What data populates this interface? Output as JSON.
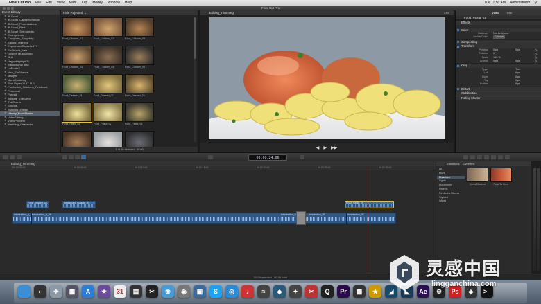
{
  "menubar": {
    "app": "Final Cut Pro",
    "items": [
      "File",
      "Edit",
      "View",
      "Mark",
      "Clip",
      "Modify",
      "Window",
      "Help"
    ],
    "clock": "Tue 11:50 AM",
    "user": "Administrator"
  },
  "window": {
    "title": "Final Cut Pro"
  },
  "library": {
    "header": "Event Library",
    "items": [
      "iB-Scroll",
      "iB-Scroll_CaptainWinslow",
      "iB-Scroll_Presentations",
      "iB-Scroll_Rest",
      "iB-Scroll_Seth-media",
      "ChampNews",
      "Computer_StoryHelp",
      "Editing_Training",
      "ExperimentCancelledTY",
      "FixShop/a_Idea",
      "Gospel_Music/Video",
      "Grid",
      "HappyHighlightTi",
      "Instructional_Bits",
      "LaRouteY",
      "Map_ForShapes",
      "Mapper",
      "MicroSoldering",
      "Blue Paper 11.11.11.1",
      "Production_Sessions_Feedback",
      "Personnel",
      "Portrait",
      "Tailgate_TheSwell",
      "TheCharm",
      "Sounds",
      "Tutorials_Editing",
      "Udemy_Food/Basics",
      "VideoEditing",
      "VideoProblem",
      "Wedding_Chansons"
    ],
    "selected_index": 26
  },
  "browser": {
    "filter": "Hide Rejected",
    "clips": [
      "Food_Chicken_01",
      "Food_Chicken_02",
      "Food_Chicken_03",
      "",
      "Food_Chicken_04",
      "Food_Chicken_05",
      "Food_Chicken_06",
      "",
      "Food_Dessert_01",
      "Food_Dessert_02",
      "Food_Dessert_03",
      "",
      "Food_Pasta_01",
      "Food_Pasta_02",
      "Food_Pasta_03",
      "",
      "Food_Pasta_04",
      "Food_Plate_01",
      "Food_Plate_02",
      "",
      "Food_Plate_03",
      "Food_Plate_04",
      "Food_PIC_Layla_01",
      ""
    ],
    "footer": "1 of 46 selected, 00:09"
  },
  "viewer": {
    "title": "Editing_Trimming",
    "zoom": "43%",
    "transport": [
      "◀",
      "▶",
      "▶▶"
    ]
  },
  "inspector": {
    "tabs": [
      "Video",
      "Info"
    ],
    "clip_name": "Food_Pasta_01",
    "sections": {
      "effects": "Effects",
      "color": "Color",
      "compositing": "Compositing",
      "transform": "Transform",
      "crop": "Crop",
      "distort": "Distort",
      "stabilization": "Stabilization",
      "rolling_shutter": "Rolling Shutter"
    },
    "color_rows": [
      {
        "k": "Balance:",
        "v": "Not Analyzed"
      },
      {
        "k": "Match Color:",
        "v": "Choose"
      }
    ],
    "transform_rows": [
      {
        "k": "Position",
        "x": "0 px",
        "y": "0 px"
      },
      {
        "k": "Rotation",
        "x": "0°",
        "y": ""
      },
      {
        "k": "Scale",
        "x": "100 %",
        "y": ""
      },
      {
        "k": "Anchor",
        "x": "0 px",
        "y": "0 px"
      }
    ],
    "crop_rows": [
      {
        "k": "Type:",
        "v": "Trim"
      },
      {
        "k": "Left",
        "v": "0 px"
      },
      {
        "k": "Right",
        "v": "0 px"
      },
      {
        "k": "Top",
        "v": "0 px"
      },
      {
        "k": "Bottom",
        "v": "0 px"
      }
    ]
  },
  "toolbar": {
    "timecode": "00:00:24:06"
  },
  "timeline": {
    "title": "Editing_Trimming",
    "ruler": [
      "00:00:00:00",
      "00:00:05:00",
      "00:00:10:00",
      "00:00:15:00",
      "00:00:20:00",
      "00:00:25:00",
      "00:00:30:00"
    ],
    "connected_clips": [
      "Food_Dessert_02",
      "Restaurant_Outside_01",
      "Food_Pasta_01"
    ],
    "primary_labels": [
      "Introduction_A_V7",
      "Introduction_A_V8",
      "Introduction_01",
      "Introduction_02",
      "Introduction_03"
    ]
  },
  "transitions": {
    "header": "Transitions",
    "count": "Overview",
    "categories": [
      "All",
      "Blurs",
      "Dissolves",
      "Lights",
      "Movements",
      "Objects",
      "Replicator/Clones",
      "Stylized",
      "Wipes"
    ],
    "selected_index": 2,
    "items": [
      "Cross Dissolve",
      "Fade To Color"
    ]
  },
  "status": {
    "text": "00:09 selected - 00:51 total"
  },
  "watermark": {
    "cn": "灵感中国",
    "en": "lingganchina.com"
  }
}
